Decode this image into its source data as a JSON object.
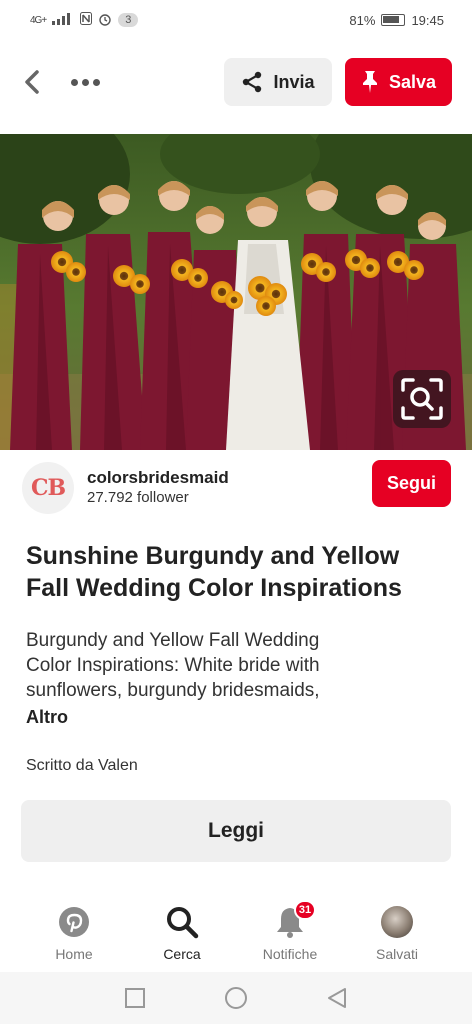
{
  "status_bar": {
    "signal": "4G+",
    "notification_count": "3",
    "battery": "81%",
    "time": "19:45"
  },
  "top_bar": {
    "send_label": "Invia",
    "save_label": "Salva"
  },
  "creator": {
    "avatar_text": "CB",
    "name": "colorsbridesmaid",
    "followers": "27.792 follower",
    "follow_label": "Segui"
  },
  "pin": {
    "title": "Sunshine Burgundy and Yellow Fall Wedding Color Inspirations",
    "description": "Burgundy and Yellow Fall Wedding Color Inspirations: White bride with sunflowers, burgundy bridesmaids,",
    "more_label": "Altro",
    "author": "Scritto da Valen",
    "read_label": "Leggi"
  },
  "bottom_nav": {
    "items": [
      {
        "label": "Home",
        "icon": "pinterest-logo-icon"
      },
      {
        "label": "Cerca",
        "icon": "search-icon"
      },
      {
        "label": "Notifiche",
        "icon": "bell-icon",
        "badge": "31"
      },
      {
        "label": "Salvati",
        "icon": "profile-avatar"
      }
    ]
  },
  "colors": {
    "brand_red": "#e60023",
    "burgundy": "#7d1730",
    "sunflower": "#f2a81d"
  }
}
